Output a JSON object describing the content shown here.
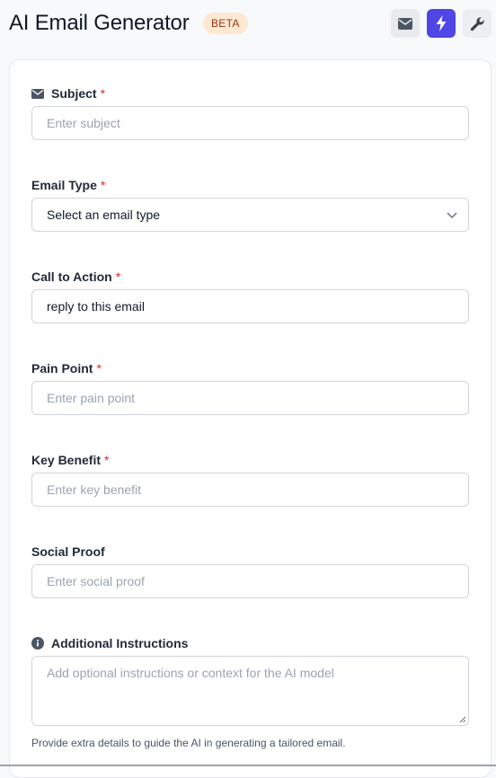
{
  "header": {
    "title": "AI Email Generator",
    "badge": "BETA",
    "buttons": [
      "mail-icon",
      "bolt-icon",
      "wrench-icon"
    ]
  },
  "form": {
    "subject": {
      "label": "Subject",
      "required": "*",
      "placeholder": "Enter subject"
    },
    "email_type": {
      "label": "Email Type",
      "required": "*",
      "selected": "Select an email type"
    },
    "call_to_action": {
      "label": "Call to Action",
      "required": "*",
      "value": "reply to this email"
    },
    "pain_point": {
      "label": "Pain Point",
      "required": "*",
      "placeholder": "Enter pain point"
    },
    "key_benefit": {
      "label": "Key Benefit",
      "required": "*",
      "placeholder": "Enter key benefit"
    },
    "social_proof": {
      "label": "Social Proof",
      "placeholder": "Enter social proof"
    },
    "additional_instructions": {
      "label": "Additional Instructions",
      "placeholder": "Add optional instructions or context for the AI model",
      "help": "Provide extra details to guide the AI in generating a tailored email."
    }
  },
  "colors": {
    "accent": "#4f46e5",
    "required": "#dc2626",
    "badge_bg": "#fde9d3"
  }
}
